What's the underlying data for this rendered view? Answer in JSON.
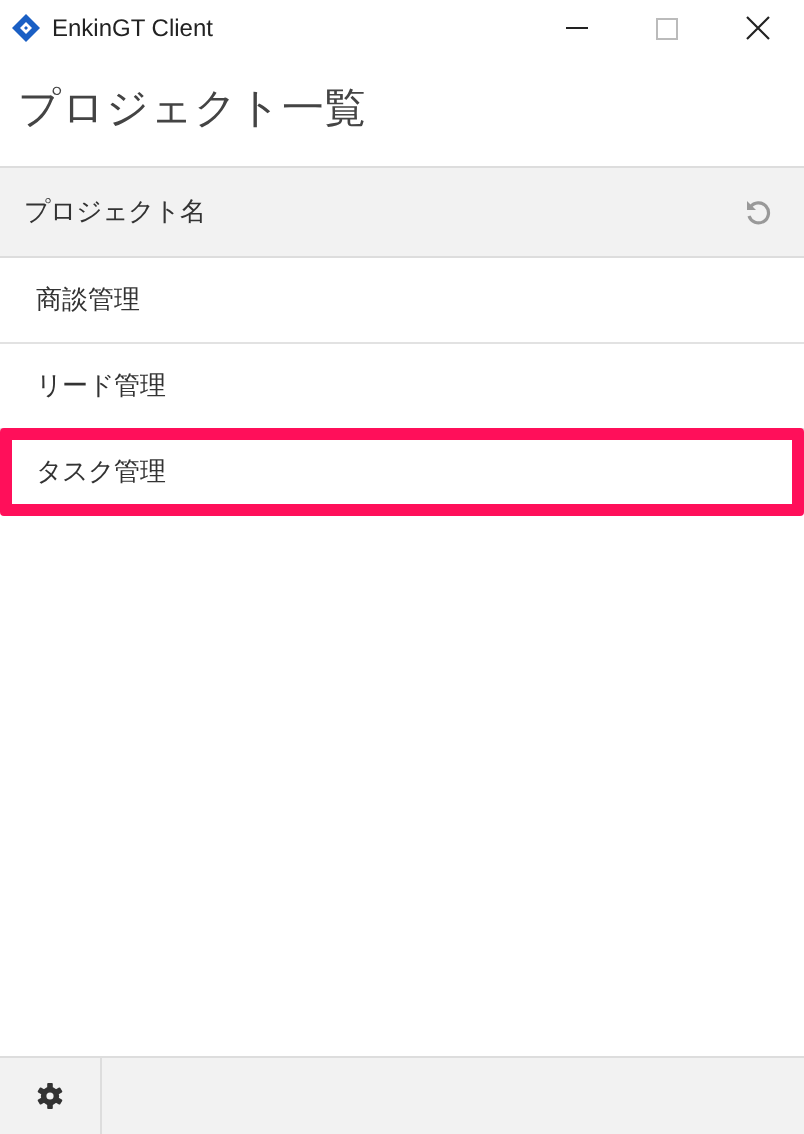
{
  "window": {
    "title": "EnkinGT Client"
  },
  "heading": "プロジェクト一覧",
  "table": {
    "column": "プロジェクト名",
    "rows": [
      {
        "name": "商談管理",
        "highlighted": false
      },
      {
        "name": "リード管理",
        "highlighted": false
      },
      {
        "name": "タスク管理",
        "highlighted": true
      }
    ]
  }
}
